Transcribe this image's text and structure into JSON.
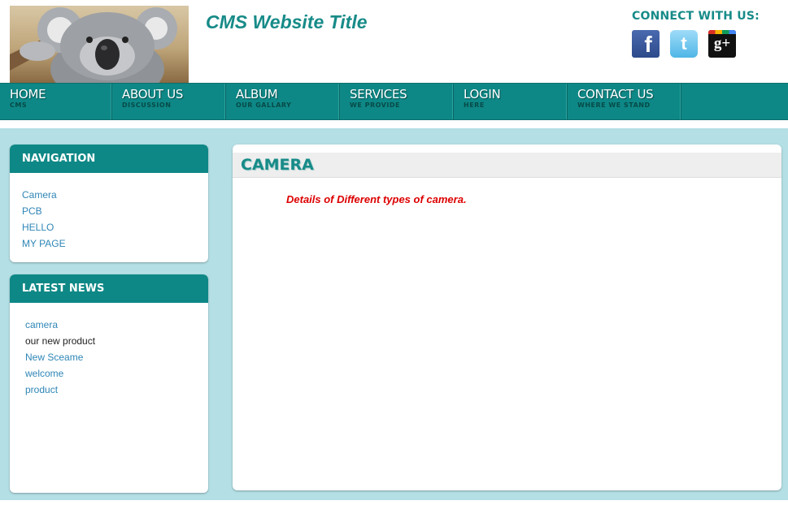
{
  "header": {
    "site_title": "CMS Website Title",
    "connect_title": "CONNECT WITH US:",
    "social": [
      {
        "icon": "facebook-icon",
        "glyph": "f"
      },
      {
        "icon": "twitter-icon",
        "glyph": "t"
      },
      {
        "icon": "google-plus-icon",
        "glyph": "g+"
      }
    ]
  },
  "menu": [
    {
      "label": "HOME",
      "sub": "CMS"
    },
    {
      "label": "ABOUT US",
      "sub": "DISCUSSION"
    },
    {
      "label": "ALBUM",
      "sub": "OUR GALLARY"
    },
    {
      "label": "SERVICES",
      "sub": "WE PROVIDE"
    },
    {
      "label": "LOGIN",
      "sub": "HERE"
    },
    {
      "label": "CONTACT US",
      "sub": "WHERE WE STAND"
    }
  ],
  "sidebar": {
    "navigation": {
      "title": "NAVIGATION",
      "items": [
        "Camera",
        "PCB",
        "HELLO",
        "MY PAGE"
      ]
    },
    "news": {
      "title": "LATEST NEWS",
      "items": [
        "camera",
        "our new product",
        "New Sceame",
        "welcome",
        "product"
      ]
    }
  },
  "main": {
    "heading": "CAMERA",
    "text": "Details of Different types of camera."
  },
  "colors": {
    "teal": "#0e8886",
    "title_teal": "#178b88",
    "page_bg": "#b3dfe5",
    "link_blue": "#2f86b6",
    "alert_red": "#dd0000"
  }
}
